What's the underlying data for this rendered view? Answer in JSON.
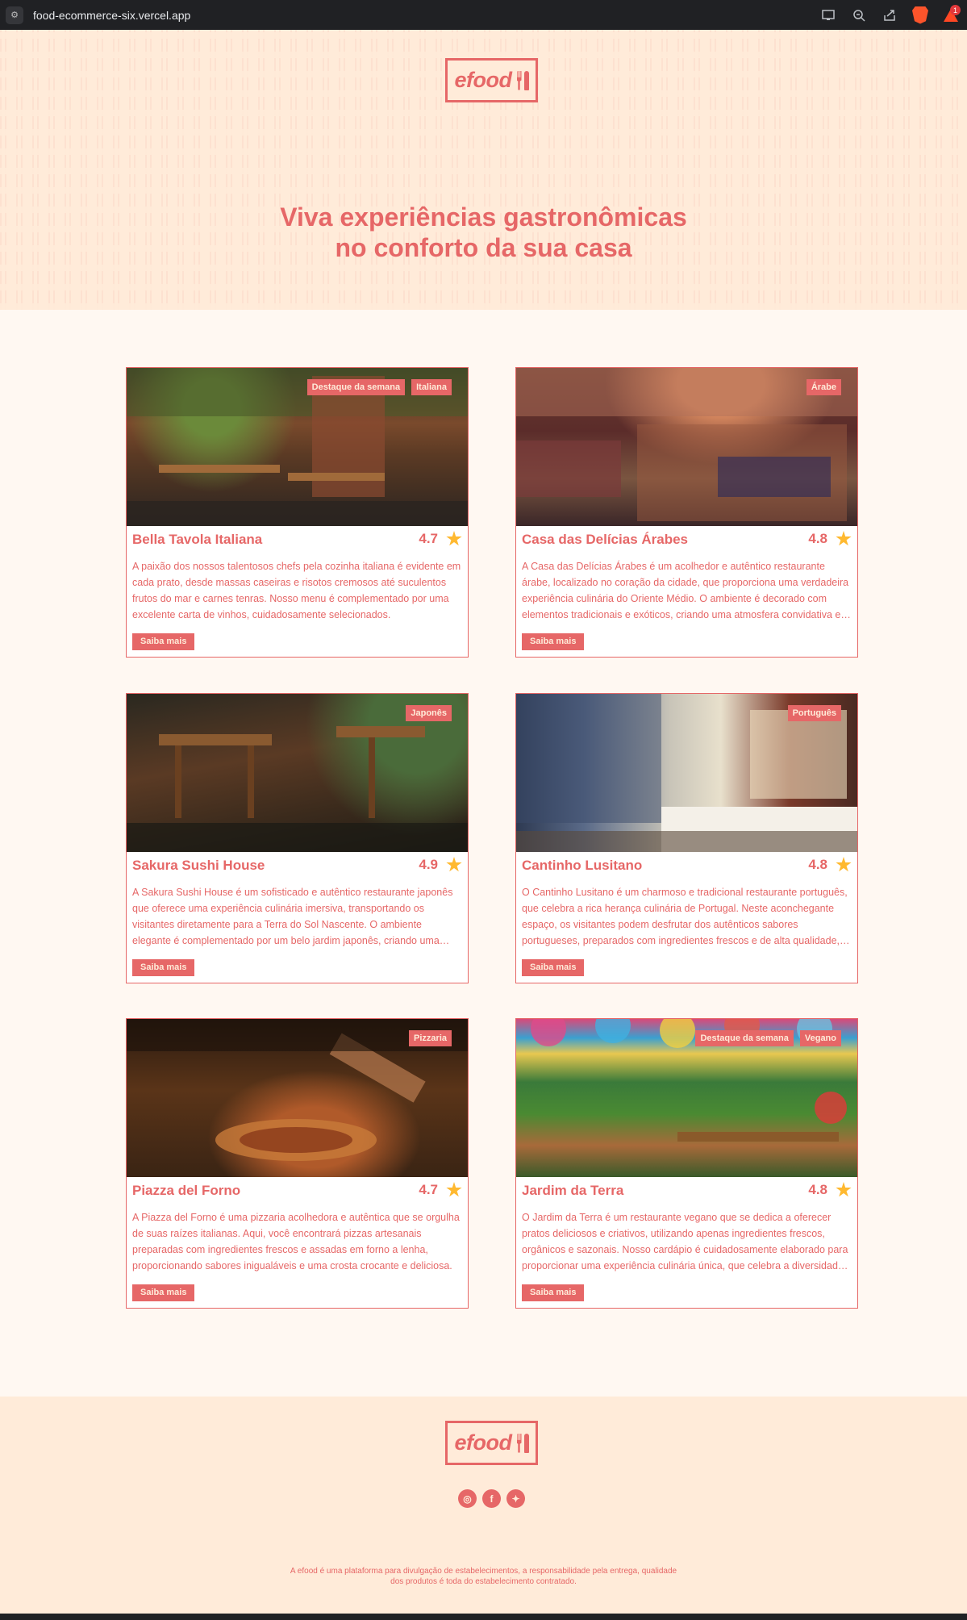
{
  "browser": {
    "url": "food-ecommerce-six.vercel.app",
    "notification_count": "1"
  },
  "brand": {
    "logo_text": "efood",
    "primary_color": "#E66767",
    "background_light": "#FFEBD9",
    "background_page": "#FFF8F2",
    "star_color": "#FFB930"
  },
  "hero": {
    "title_line1": "Viva experiências gastronômicas",
    "title_line2": "no conforto da sua casa"
  },
  "restaurants": [
    {
      "name": "Bella Tavola Italiana",
      "rating": "4.7",
      "tags": [
        "Destaque da semana",
        "Italiana"
      ],
      "description": "A paixão dos nossos talentosos chefs pela cozinha italiana é evidente em cada prato, desde massas caseiras e risotos cremosos até suculentos frutos do mar e carnes tenras. Nosso menu é complementado por uma excelente carta de vinhos, cuidadosamente selecionados.",
      "button": "Saiba mais"
    },
    {
      "name": "Casa das Delícias Árabes",
      "rating": "4.8",
      "tags": [
        "Árabe"
      ],
      "description": "A Casa das Delícias Árabes é um acolhedor e autêntico restaurante árabe, localizado no coração da cidade, que proporciona uma verdadeira experiência culinária do Oriente Médio. O ambiente é decorado com elementos tradicionais e exóticos, criando uma atmosfera convidativa e aconchegante.",
      "button": "Saiba mais"
    },
    {
      "name": "Sakura Sushi House",
      "rating": "4.9",
      "tags": [
        "Japonês"
      ],
      "description": "A Sakura Sushi House é um sofisticado e autêntico restaurante japonês que oferece uma experiência culinária imersiva, transportando os visitantes diretamente para a Terra do Sol Nascente. O ambiente elegante é complementado por um belo jardim japonês, criando uma atmosfera serena.",
      "button": "Saiba mais"
    },
    {
      "name": "Cantinho Lusitano",
      "rating": "4.8",
      "tags": [
        "Português"
      ],
      "description": "O Cantinho Lusitano é um charmoso e tradicional restaurante português, que celebra a rica herança culinária de Portugal. Neste aconchegante espaço, os visitantes podem desfrutar dos autênticos sabores portugueses, preparados com ingredientes frescos e de alta qualidade, seguindo receitas tradicionais.",
      "button": "Saiba mais"
    },
    {
      "name": "Piazza del Forno",
      "rating": "4.7",
      "tags": [
        "Pizzaria"
      ],
      "description": "A Piazza del Forno é uma pizzaria acolhedora e autêntica que se orgulha de suas raízes italianas. Aqui, você encontrará pizzas artesanais preparadas com ingredientes frescos e assadas em forno a lenha, proporcionando sabores inigualáveis e uma crosta crocante e deliciosa.",
      "button": "Saiba mais"
    },
    {
      "name": "Jardim da Terra",
      "rating": "4.8",
      "tags": [
        "Destaque da semana",
        "Vegano"
      ],
      "description": "O Jardim da Terra é um restaurante vegano que se dedica a oferecer pratos deliciosos e criativos, utilizando apenas ingredientes frescos, orgânicos e sazonais. Nosso cardápio é cuidadosamente elaborado para proporcionar uma experiência culinária única, que celebra a diversidade dos alimentos vegetais.",
      "button": "Saiba mais"
    }
  ],
  "footer": {
    "logo_text": "efood",
    "socials": [
      {
        "name": "instagram-icon",
        "glyph": "◎"
      },
      {
        "name": "facebook-icon",
        "glyph": "f"
      },
      {
        "name": "twitter-icon",
        "glyph": "✦"
      }
    ],
    "disclaimer_line1": "A efood é uma plataforma para divulgação de estabelecimentos, a responsabilidade pela entrega, qualidade",
    "disclaimer_line2": "dos produtos é toda do estabelecimento contratado."
  }
}
